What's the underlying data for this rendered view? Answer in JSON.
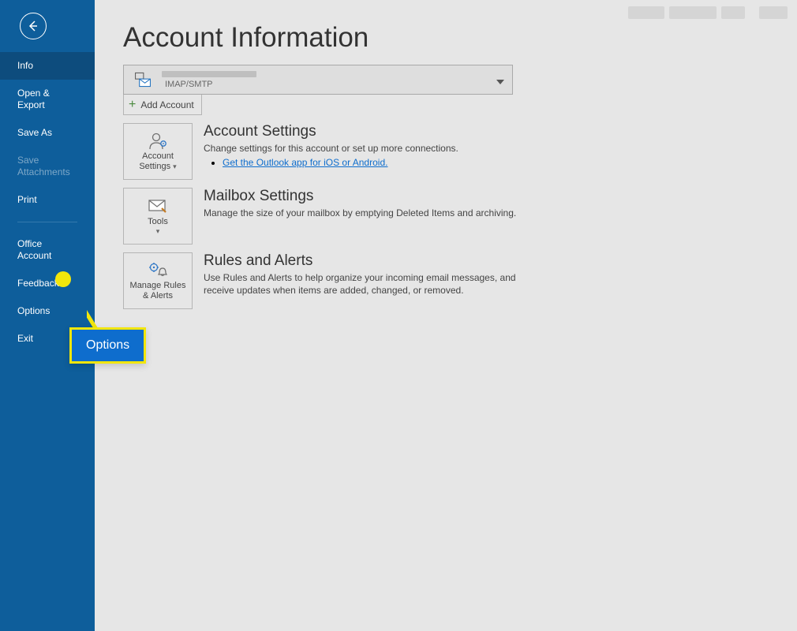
{
  "sidebar": {
    "items": [
      {
        "label": "Info",
        "selected": true,
        "disabled": false
      },
      {
        "label": "Open & Export",
        "selected": false,
        "disabled": false
      },
      {
        "label": "Save As",
        "selected": false,
        "disabled": false
      },
      {
        "label": "Save Attachments",
        "selected": false,
        "disabled": true
      },
      {
        "label": "Print",
        "selected": false,
        "disabled": false
      }
    ],
    "items2": [
      {
        "label": "Office Account"
      },
      {
        "label": "Feedback"
      },
      {
        "label": "Options"
      },
      {
        "label": "Exit"
      }
    ]
  },
  "page": {
    "title": "Account Information"
  },
  "account": {
    "type_label": "IMAP/SMTP",
    "add_account_label": "Add Account"
  },
  "sections": {
    "account_settings": {
      "tile_line1": "Account",
      "tile_line2": "Settings",
      "title": "Account Settings",
      "desc": "Change settings for this account or set up more connections.",
      "link": "Get the Outlook app for iOS or Android."
    },
    "mailbox_settings": {
      "tile_line1": "Tools",
      "title": "Mailbox Settings",
      "desc": "Manage the size of your mailbox by emptying Deleted Items and archiving."
    },
    "rules_alerts": {
      "tile_line1": "Manage Rules",
      "tile_line2": "& Alerts",
      "title": "Rules and Alerts",
      "desc": "Use Rules and Alerts to help organize your incoming email messages, and receive updates when items are added, changed, or removed."
    }
  },
  "callout": {
    "label": "Options"
  }
}
